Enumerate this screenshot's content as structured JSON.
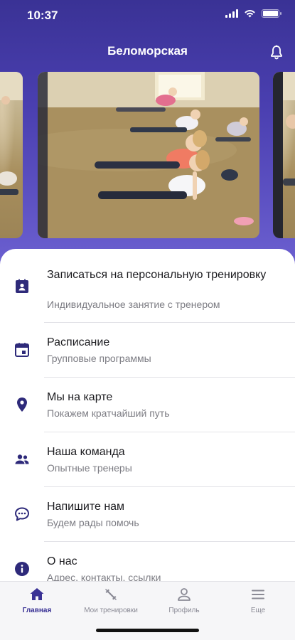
{
  "status_bar": {
    "time": "10:37"
  },
  "header": {
    "title": "Беломорская"
  },
  "menu": [
    {
      "title": "Записаться на персональную тренировку",
      "subtitle": "Индивидуальное занятие с тренером",
      "icon": "badge-icon"
    },
    {
      "title": "Расписание",
      "subtitle": "Групповые программы",
      "icon": "calendar-icon"
    },
    {
      "title": "Мы на карте",
      "subtitle": "Покажем кратчайший путь",
      "icon": "location-pin-icon"
    },
    {
      "title": "Наша команда",
      "subtitle": "Опытные тренеры",
      "icon": "people-icon"
    },
    {
      "title": "Напишите нам",
      "subtitle": "Будем рады помочь",
      "icon": "chat-icon"
    },
    {
      "title": "О нас",
      "subtitle": "Адрес, контакты, ссылки",
      "icon": "info-icon"
    }
  ],
  "tabs": [
    {
      "label": "Главная",
      "icon": "home-icon",
      "active": true
    },
    {
      "label": "Мои тренировки",
      "icon": "dumbbell-icon",
      "active": false
    },
    {
      "label": "Профиль",
      "icon": "person-icon",
      "active": false
    },
    {
      "label": "Еще",
      "icon": "menu-icon",
      "active": false
    }
  ],
  "colors": {
    "accent": "#3a3295",
    "header_gradient_top": "#3a3295",
    "header_gradient_bottom": "#6b5fd0",
    "icon": "#2e2a7a",
    "subtitle": "#7c7c83"
  }
}
